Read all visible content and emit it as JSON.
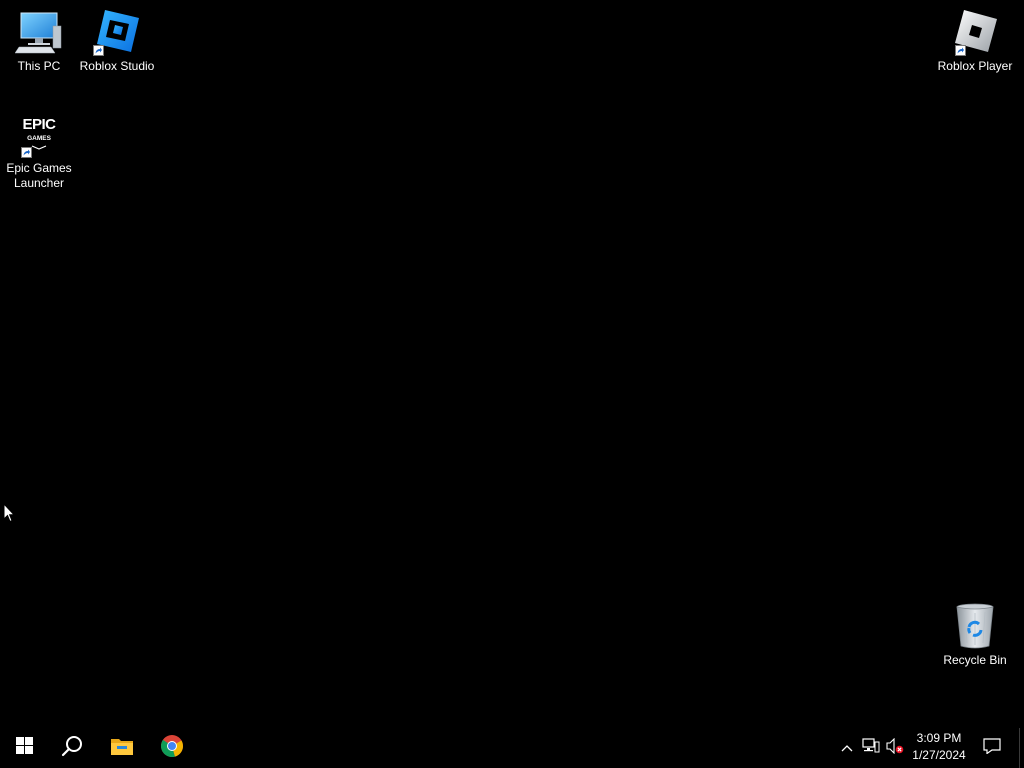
{
  "desktop": {
    "background": "#000000",
    "icons": {
      "this_pc": {
        "label": "This PC",
        "icon": "computer-icon"
      },
      "roblox_studio": {
        "label": "Roblox Studio",
        "icon": "roblox-studio-icon",
        "shortcut": true
      },
      "roblox_player": {
        "label": "Roblox Player",
        "icon": "roblox-player-icon",
        "shortcut": true
      },
      "epic_games": {
        "label": "Epic Games Launcher",
        "icon": "epic-games-icon",
        "shortcut": true,
        "logo_text": "EPIC GAMES"
      },
      "recycle_bin": {
        "label": "Recycle Bin",
        "icon": "recycle-bin-icon"
      }
    }
  },
  "taskbar": {
    "background": "#000000",
    "pinned": [
      {
        "name": "Start",
        "icon": "windows-start-icon"
      },
      {
        "name": "Search",
        "icon": "search-icon"
      },
      {
        "name": "File Explorer",
        "icon": "file-explorer-icon"
      },
      {
        "name": "Google Chrome",
        "icon": "chrome-icon"
      }
    ],
    "tray": {
      "icons": [
        "chevron-up-icon",
        "network-icon",
        "volume-muted-icon",
        "notifications-icon"
      ],
      "time": "3:09 PM",
      "date": "1/27/2024"
    }
  }
}
